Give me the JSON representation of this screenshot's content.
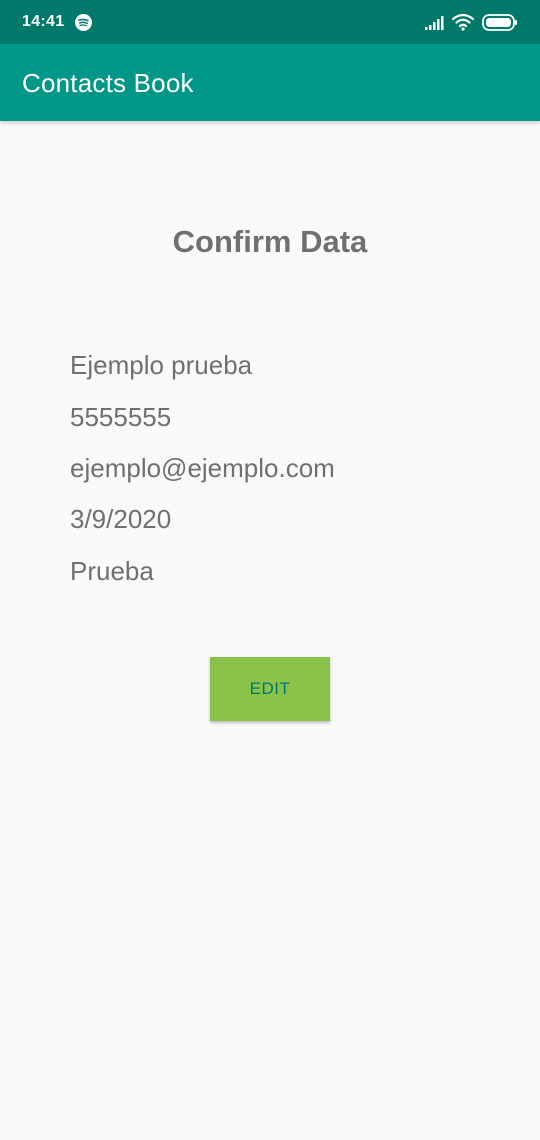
{
  "status_bar": {
    "time": "14:41",
    "icons": [
      "spotify-icon",
      "cell-signal-icon",
      "wifi-icon",
      "battery-icon"
    ]
  },
  "app_bar": {
    "title": "Contacts Book",
    "color": "#009688"
  },
  "main": {
    "title": "Confirm Data",
    "fields": {
      "name": "Ejemplo prueba",
      "phone": "5555555",
      "email": "ejemplo@ejemplo.com",
      "date": "3/9/2020",
      "description": "Prueba"
    },
    "edit_button_label": "EDIT",
    "edit_button_color": "#8bc34a"
  }
}
